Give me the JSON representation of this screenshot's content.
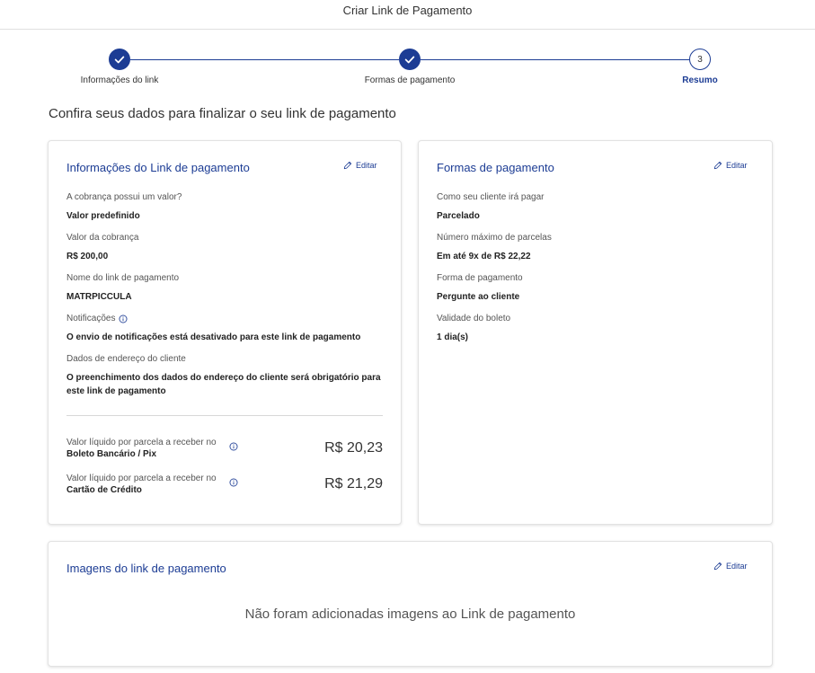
{
  "header": {
    "title": "Criar Link de Pagamento"
  },
  "stepper": {
    "steps": [
      {
        "label": "Informações do link",
        "status": "done"
      },
      {
        "label": "Formas de pagamento",
        "status": "done"
      },
      {
        "label": "Resumo",
        "number": "3",
        "status": "active"
      }
    ]
  },
  "headline": "Confira seus dados para finalizar o seu link de pagamento",
  "info_card": {
    "title": "Informações do Link de pagamento",
    "edit_label": "Editar",
    "fields": [
      {
        "label": "A cobrança possui um valor?",
        "value": "Valor predefinido"
      },
      {
        "label": "Valor da cobrança",
        "value": "R$ 200,00"
      },
      {
        "label": "Nome do link de pagamento",
        "value": "MATRPICCULA"
      },
      {
        "label": "Notificações",
        "value": "O envio de notificações está desativado para este link de pagamento"
      },
      {
        "label": "Dados de endereço do cliente",
        "value": "O preenchimento dos dados do endereço do cliente será obrigatório para este link de pagamento"
      }
    ],
    "net_values": [
      {
        "label": "Valor líquido por parcela a receber no",
        "method": "Boleto Bancário / Pix",
        "value": "R$ 20,23"
      },
      {
        "label": "Valor líquido por parcela a receber no",
        "method": "Cartão de Crédito",
        "value": "R$ 21,29"
      }
    ]
  },
  "payment_card": {
    "title": "Formas de pagamento",
    "edit_label": "Editar",
    "fields": [
      {
        "label": "Como seu cliente irá pagar",
        "value": "Parcelado"
      },
      {
        "label": "Número máximo de parcelas",
        "value": "Em até 9x de R$ 22,22"
      },
      {
        "label": "Forma de pagamento",
        "value": "Pergunte ao cliente"
      },
      {
        "label": "Validade do boleto",
        "value": "1 dia(s)"
      }
    ]
  },
  "images_card": {
    "title": "Imagens do link de pagamento",
    "edit_label": "Editar",
    "empty_message": "Não foram adicionadas imagens ao Link de pagamento"
  },
  "colors": {
    "primary": "#1c3c94",
    "text": "#333333",
    "border": "#e2e2e2"
  }
}
